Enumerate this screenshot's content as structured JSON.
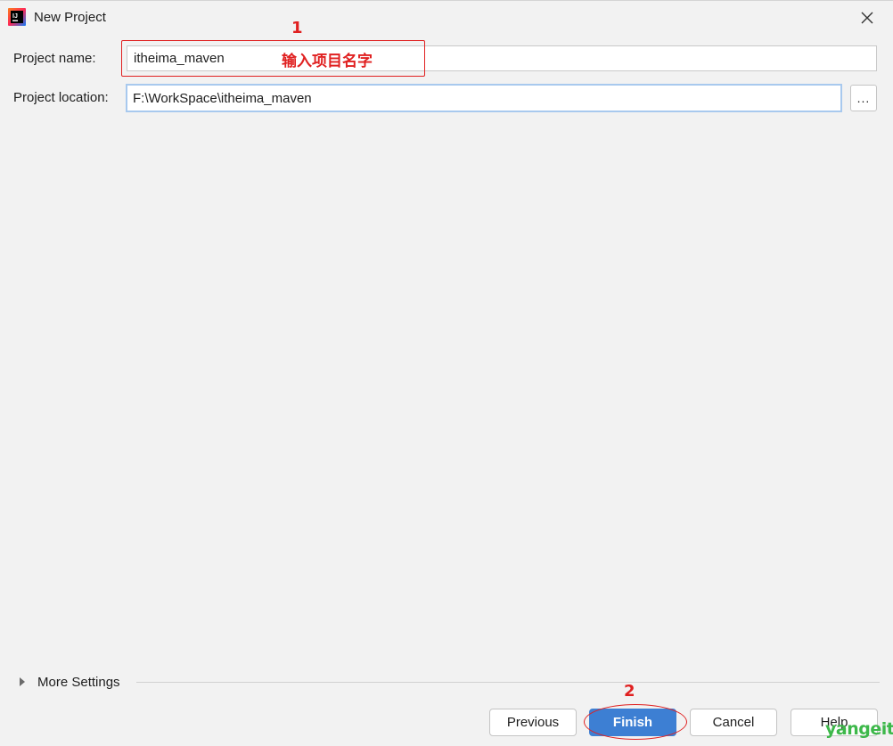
{
  "window": {
    "title": "New Project",
    "close_symbol": "✕",
    "app_icon": "intellij-idea-icon"
  },
  "form": {
    "project_name_label": "Project name:",
    "project_name_value": "itheima_maven",
    "project_location_label": "Project location:",
    "project_location_value": "F:\\WorkSpace\\itheima_maven",
    "browse_label": "..."
  },
  "annotations": {
    "step1_number": "1",
    "step1_text": "输入项目名字",
    "step2_number": "2",
    "color": "#e02020"
  },
  "more_settings": {
    "label": "More Settings"
  },
  "footer": {
    "previous_label": "Previous",
    "finish_label": "Finish",
    "cancel_label": "Cancel",
    "help_label": "Help"
  },
  "watermark": "yangeit",
  "colors": {
    "primary_button": "#3d7fd3",
    "focus_border": "#a8c9ee",
    "background": "#f2f2f2"
  }
}
